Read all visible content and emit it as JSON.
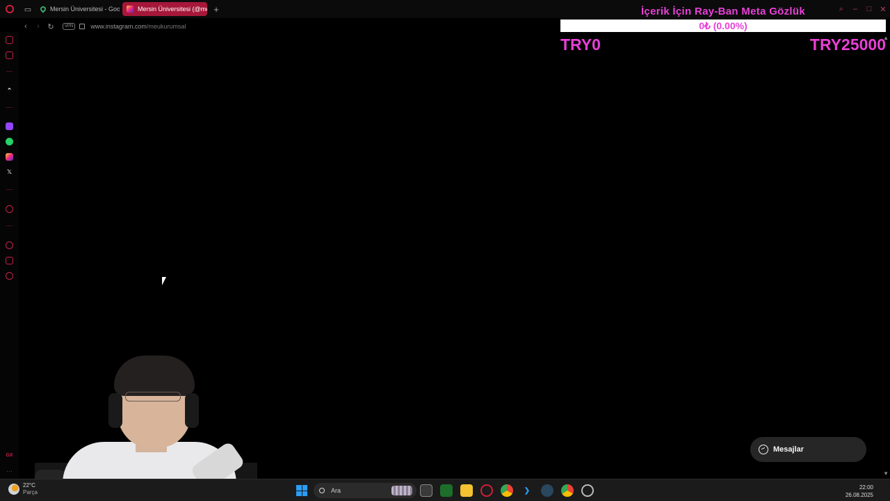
{
  "tabs": [
    {
      "title": "Mersin Üniversitesi - Goo",
      "icon": "maps-pin-icon"
    },
    {
      "title": "Mersin Üniversitesi (@me",
      "icon": "instagram-icon",
      "active": true
    }
  ],
  "address_bar": {
    "vpn_label": "VPN",
    "url_host": "www.instagram.com",
    "url_path": "/meukurumsal"
  },
  "sidebar": {
    "icons": [
      "aria-icon",
      "messenger-icon",
      "arrow-up-icon",
      "twitch-icon",
      "whatsapp-icon",
      "instagram-icon",
      "x-icon",
      "player-icon",
      "history-icon",
      "pinboard-icon",
      "settings-icon",
      "gx-icon",
      "more-icon"
    ]
  },
  "donation": {
    "title": "İçerik İçin Ray-Ban Meta Gözlük",
    "progress_text": "0₺ (0.00%)",
    "progress_fraction": 0.0,
    "min_label": "TRY0",
    "max_label": "TRY25000",
    "accent_color": "#e93fd7"
  },
  "messages_button": {
    "label": "Mesajlar"
  },
  "taskbar": {
    "weather_temp": "22°C",
    "weather_desc": "Parça",
    "search_placeholder": "Ara",
    "time": "22:00",
    "date": "26.08.2025",
    "apps": [
      "file-explorer-icon",
      "nvidia-icon",
      "folder-icon",
      "opera-icon",
      "chrome-icon",
      "vscode-icon",
      "steam-icon",
      "chrome-icon",
      "settings-icon"
    ]
  }
}
